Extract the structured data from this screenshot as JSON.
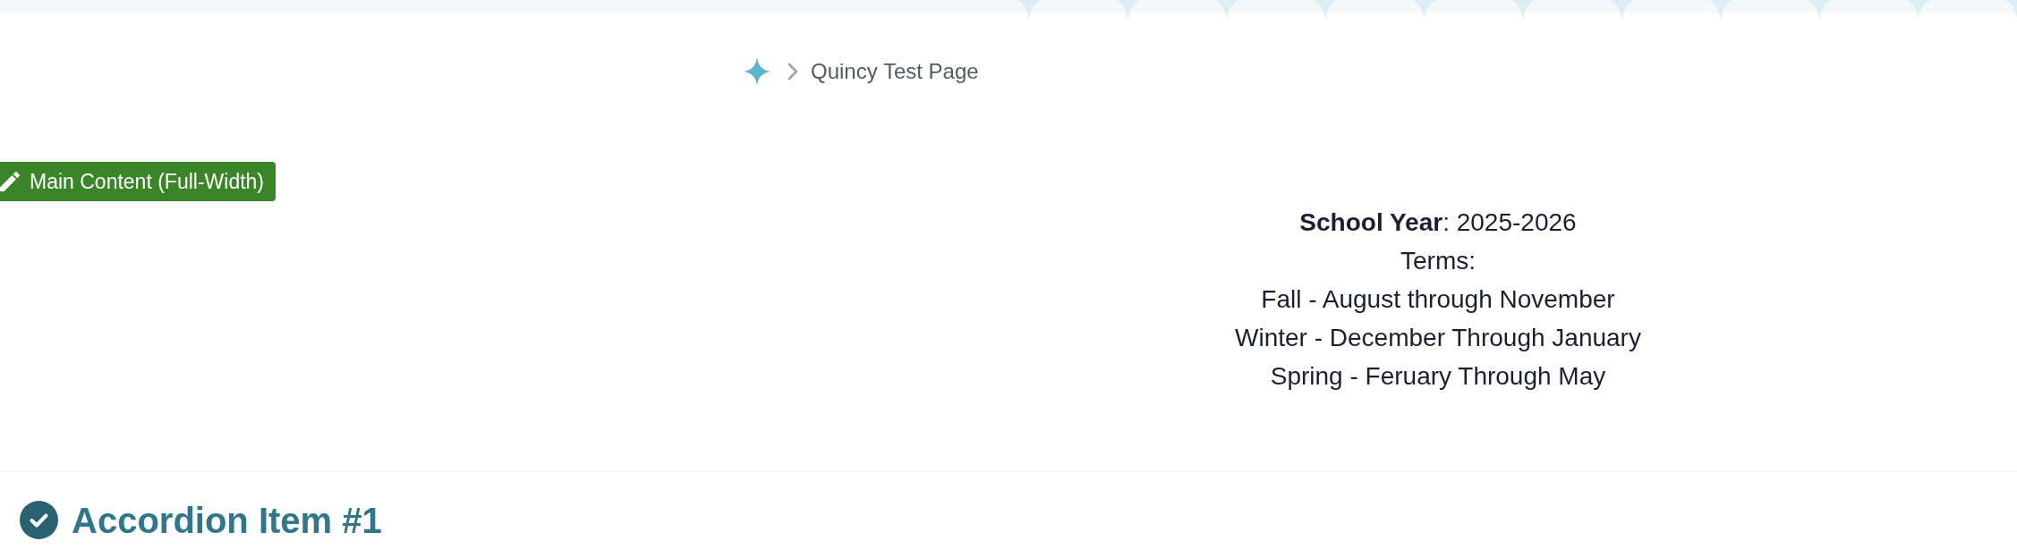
{
  "breadcrumb": {
    "items": [
      {
        "label": "Quincy Test Page"
      }
    ]
  },
  "edit_button": {
    "label": "Main Content (Full-Width)"
  },
  "content": {
    "lines": [
      "**School Year**: 2025-2026",
      "Terms:",
      "Fall - August through November",
      "Winter - December Through January",
      "Spring - Feruary Through May"
    ]
  },
  "accordion": {
    "items": [
      {
        "title": "Accordion Item #1"
      }
    ]
  }
}
